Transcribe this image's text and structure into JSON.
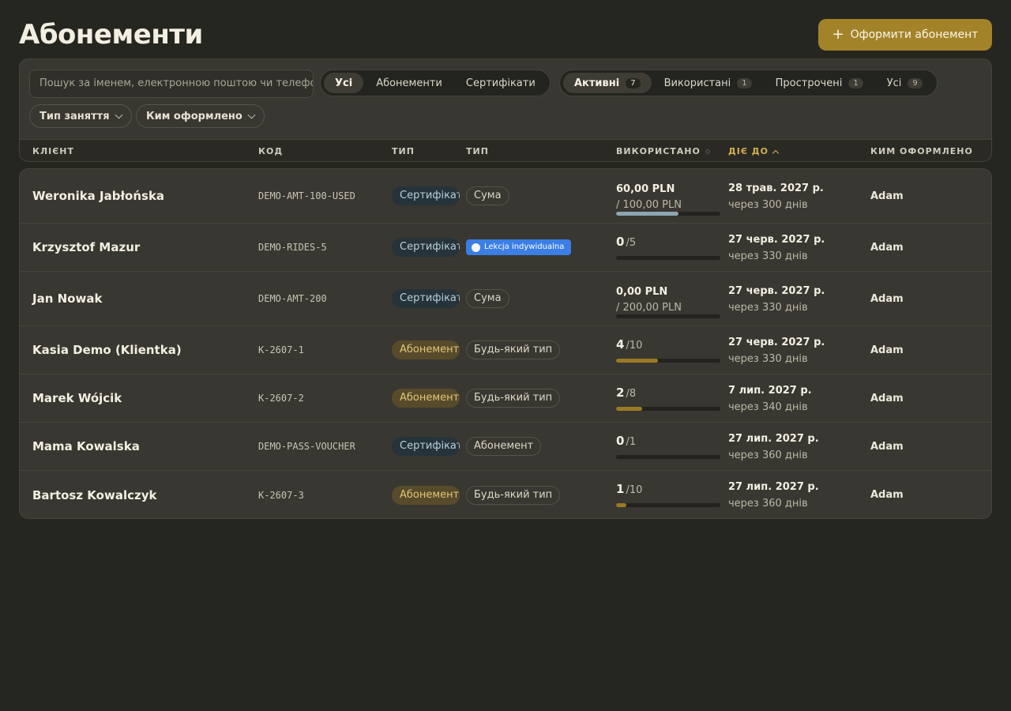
{
  "header": {
    "title": "Абонементи",
    "new_button": "Оформити абонемент",
    "new_button_icon": "plus-icon"
  },
  "filters": {
    "search_placeholder": "Пошук за іменем, електронною поштою чи телефоном",
    "kind_tabs": [
      {
        "label": "Усі",
        "active": true
      },
      {
        "label": "Абонементи",
        "active": false
      },
      {
        "label": "Сертифікати",
        "active": false
      }
    ],
    "status_tabs": [
      {
        "label": "Активні",
        "count": "7",
        "active": true
      },
      {
        "label": "Використані",
        "count": "1",
        "active": false
      },
      {
        "label": "Прострочені",
        "count": "1",
        "active": false
      },
      {
        "label": "Усі",
        "count": "9",
        "active": false
      }
    ],
    "class_type_dropdown": "Тип заняття",
    "issued_by_dropdown": "Ким оформлено"
  },
  "columns": {
    "client": "КЛІЄНТ",
    "code": "КОД",
    "type": "ТИП",
    "class_type": "ТИП",
    "used": "ВИКОРИСТАНО",
    "valid_until": "ДІЄ ДО",
    "issued_by": "КИМ ОФОРМЛЕНО"
  },
  "colors": {
    "background": "#262621",
    "accent": "#a3832a",
    "certificate_badge": "#26333a",
    "pass_badge": "#584b2c",
    "lesson_badge": "#3b7ee5"
  },
  "rows": [
    {
      "client": "Weronika Jabłońska",
      "code": "DEMO-AMT-100-USED",
      "type": "Сертифікат",
      "type_kind": "cert",
      "class_type": "Сума",
      "class_kind": "plain",
      "used_mode": "amount",
      "used_value": "60,00 PLN",
      "used_total": "/ 100,00 PLN",
      "used_fraction": 0.6,
      "valid_date": "28 трав. 2027 р.",
      "valid_rel": "через 300 днів",
      "issued_by": "Adam"
    },
    {
      "client": "Krzysztof Mazur",
      "code": "DEMO-RIDES-5",
      "type": "Сертифікат",
      "type_kind": "cert",
      "class_type": "Lekcja indywidualna",
      "class_kind": "lesson",
      "used_mode": "count",
      "used_value": "0",
      "used_total": "/5",
      "used_fraction": 0,
      "valid_date": "27 черв. 2027 р.",
      "valid_rel": "через 330 днів",
      "issued_by": "Adam"
    },
    {
      "client": "Jan Nowak",
      "code": "DEMO-AMT-200",
      "type": "Сертифікат",
      "type_kind": "cert",
      "class_type": "Сума",
      "class_kind": "plain",
      "used_mode": "amount",
      "used_value": "0,00 PLN",
      "used_total": "/ 200,00 PLN",
      "used_fraction": 0,
      "valid_date": "27 черв. 2027 р.",
      "valid_rel": "через 330 днів",
      "issued_by": "Adam"
    },
    {
      "client": "Kasia Demo (Klientka)",
      "code": "K-2607-1",
      "type": "Абонемент",
      "type_kind": "pass",
      "class_type": "Будь-який тип",
      "class_kind": "plain",
      "used_mode": "count",
      "used_value": "4",
      "used_total": "/10",
      "used_fraction": 0.4,
      "valid_date": "27 черв. 2027 р.",
      "valid_rel": "через 330 днів",
      "issued_by": "Adam"
    },
    {
      "client": "Marek Wójcik",
      "code": "K-2607-2",
      "type": "Абонемент",
      "type_kind": "pass",
      "class_type": "Будь-який тип",
      "class_kind": "plain",
      "used_mode": "count",
      "used_value": "2",
      "used_total": "/8",
      "used_fraction": 0.25,
      "valid_date": "7 лип. 2027 р.",
      "valid_rel": "через 340 днів",
      "issued_by": "Adam"
    },
    {
      "client": "Mama Kowalska",
      "code": "DEMO-PASS-VOUCHER",
      "type": "Сертифікат",
      "type_kind": "cert",
      "class_type": "Абонемент",
      "class_kind": "plain",
      "used_mode": "count",
      "used_value": "0",
      "used_total": "/1",
      "used_fraction": 0,
      "valid_date": "27 лип. 2027 р.",
      "valid_rel": "через 360 днів",
      "issued_by": "Adam"
    },
    {
      "client": "Bartosz Kowalczyk",
      "code": "K-2607-3",
      "type": "Абонемент",
      "type_kind": "pass",
      "class_type": "Будь-який тип",
      "class_kind": "plain",
      "used_mode": "count",
      "used_value": "1",
      "used_total": "/10",
      "used_fraction": 0.1,
      "valid_date": "27 лип. 2027 р.",
      "valid_rel": "через 360 днів",
      "issued_by": "Adam"
    }
  ]
}
